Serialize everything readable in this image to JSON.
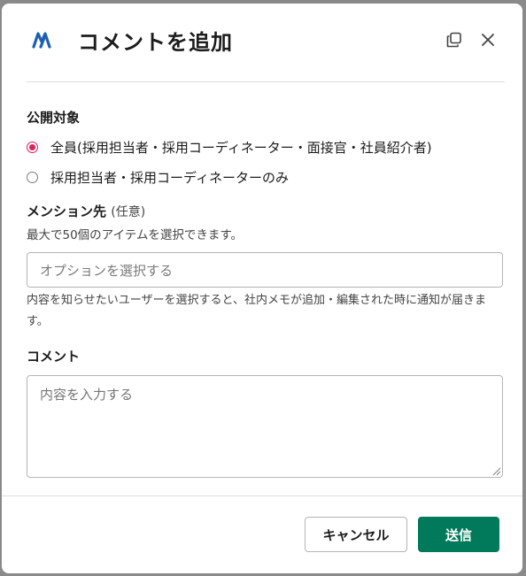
{
  "modal": {
    "title": "コメントを追加",
    "logo_icon": "brand-logo-icon",
    "header_buttons": [
      "copy-icon",
      "close-icon"
    ]
  },
  "visibility": {
    "label": "公開対象",
    "options": [
      {
        "label": "全員(採用担当者・採用コーディネーター・面接官・社員紹介者)",
        "checked": true
      },
      {
        "label": "採用担当者・採用コーディネーターのみ",
        "checked": false
      }
    ]
  },
  "mention": {
    "label": "メンション先",
    "optional": "(任意)",
    "helper": "最大で50個のアイテムを選択できます。",
    "placeholder": "オプションを選択する",
    "description": "内容を知らせたいユーザーを選択すると、社内メモが追加・編集された時に通知が届きます。"
  },
  "comment": {
    "label": "コメント",
    "placeholder": "内容を入力する"
  },
  "footer": {
    "cancel_label": "キャンセル",
    "submit_label": "送信"
  },
  "colors": {
    "primary": "#007a5a",
    "radio_checked": "#e01e5a",
    "logo": "#1d5fb3"
  }
}
